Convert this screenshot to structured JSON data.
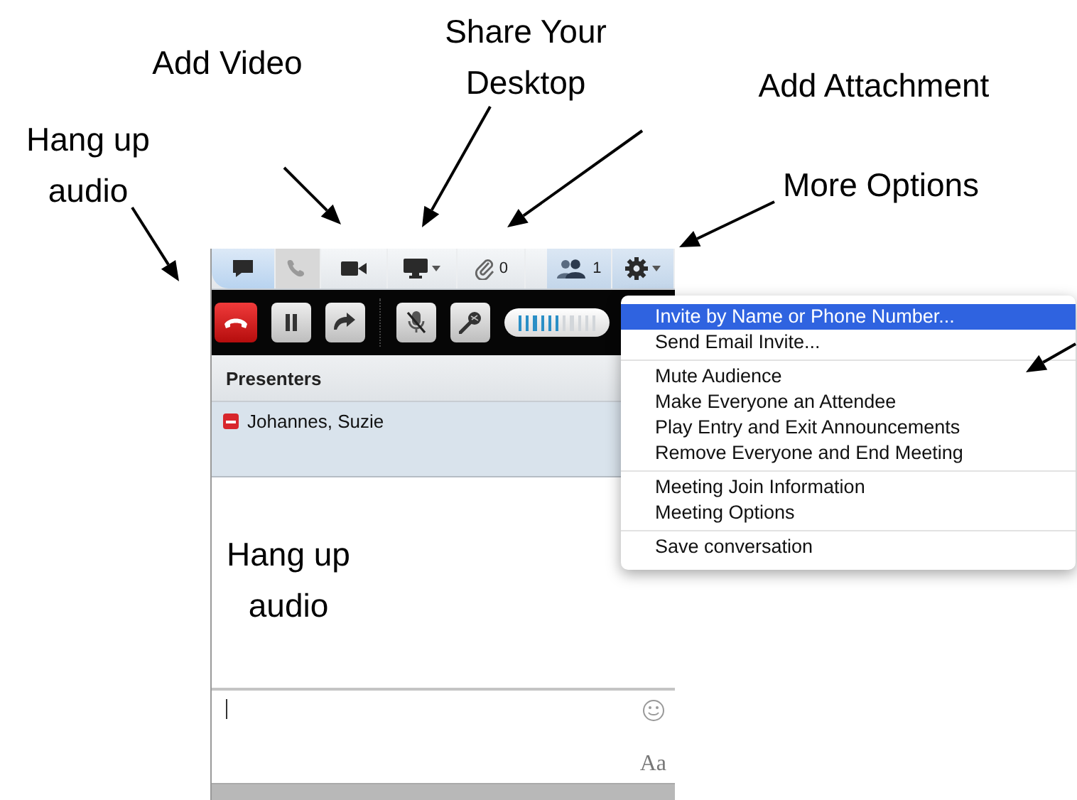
{
  "annotations": [
    {
      "text": "Add Video"
    },
    {
      "text": "Share Your Desktop"
    },
    {
      "text": "Add Attachment"
    },
    {
      "text": "Hang up audio"
    },
    {
      "text": "More Options"
    },
    {
      "text": "Hang up audio"
    }
  ],
  "toolbar": [
    {
      "kind": "chat",
      "selected": true,
      "disabled": false
    },
    {
      "kind": "phone",
      "selected": false,
      "disabled": true
    },
    {
      "kind": "video",
      "selected": false,
      "disabled": false
    },
    {
      "kind": "desktop",
      "selected": false,
      "disabled": false
    },
    {
      "kind": "attachment",
      "selected": false,
      "disabled": false,
      "count": "0"
    },
    {
      "kind": "participants",
      "selected": false,
      "disabled": false,
      "count": "1"
    },
    {
      "kind": "settings",
      "selected": false,
      "disabled": false
    }
  ],
  "audio_bar": {
    "controls": [
      {
        "kind": "hangup"
      },
      {
        "kind": "pause"
      },
      {
        "kind": "transfer"
      },
      {
        "kind": "mute"
      },
      {
        "kind": "mic"
      }
    ],
    "volume": {
      "level": 0.55
    }
  },
  "presenters": {
    "header": "Presenters",
    "items": [
      {
        "name": "Johannes, Suzie"
      }
    ]
  },
  "chat_input": {
    "font_button": "Aa"
  },
  "menu": {
    "groups": [
      [
        {
          "label": "Invite by Name or Phone Number...",
          "selected": true
        },
        {
          "label": "Send Email Invite...",
          "selected": false
        }
      ],
      [
        {
          "label": "Mute Audience",
          "selected": false
        },
        {
          "label": "Make Everyone an Attendee",
          "selected": false
        },
        {
          "label": "Play Entry and Exit Announcements",
          "selected": false
        },
        {
          "label": "Remove Everyone and End Meeting",
          "selected": false
        }
      ],
      [
        {
          "label": "Meeting Join Information",
          "selected": false
        },
        {
          "label": "Meeting Options",
          "selected": false
        }
      ],
      [
        {
          "label": "Save conversation",
          "selected": false
        }
      ]
    ]
  }
}
